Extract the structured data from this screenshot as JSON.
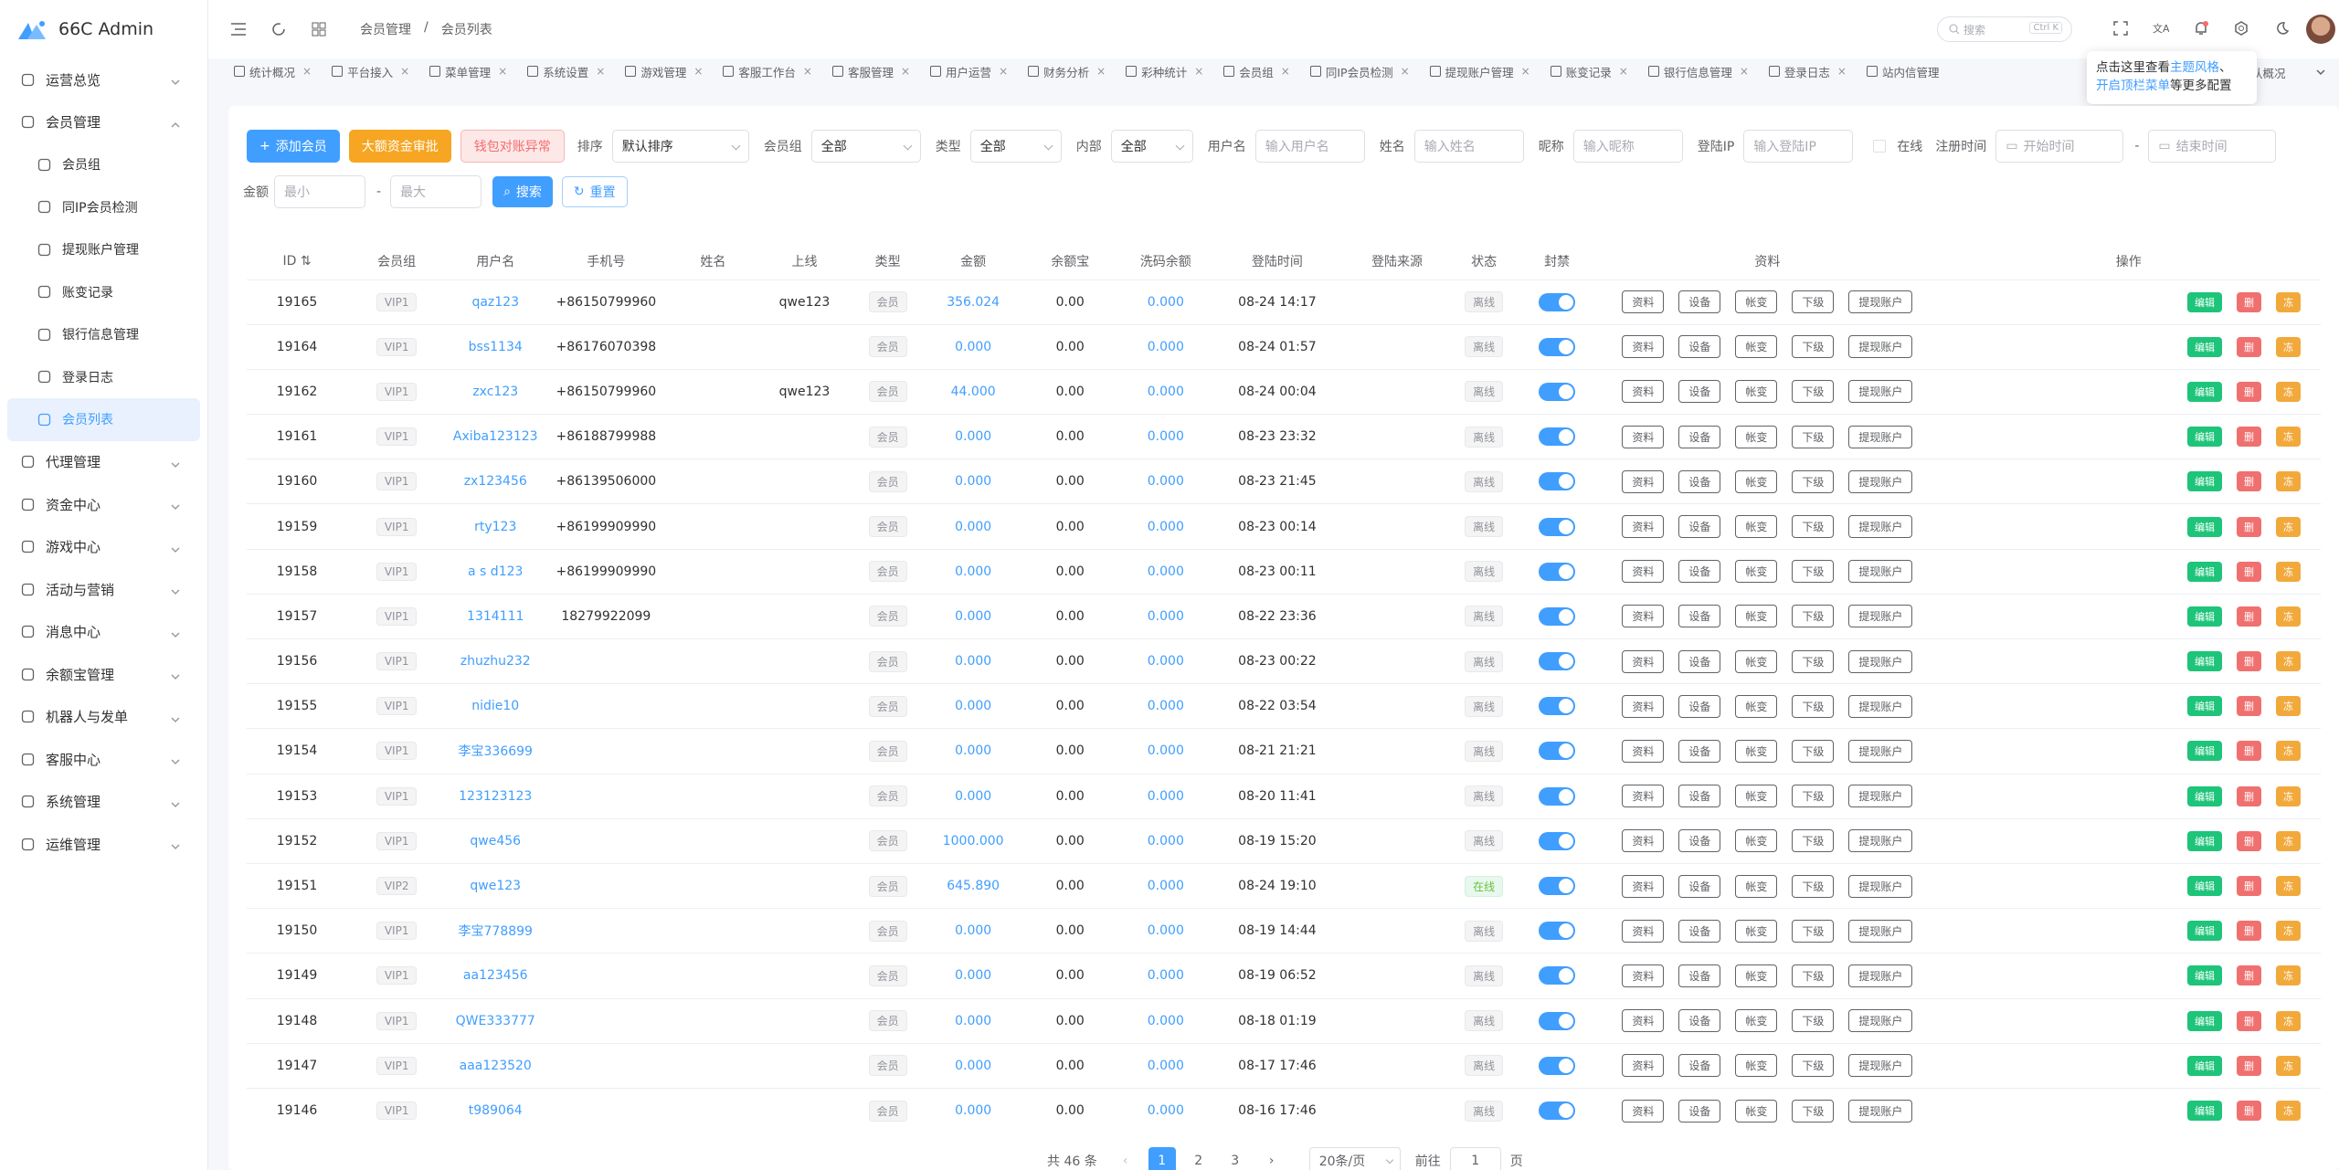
{
  "app": {
    "title": "66C Admin"
  },
  "sidebar": {
    "items": [
      {
        "label": "运营总览",
        "icon": "dashboard-icon",
        "expanded": false
      },
      {
        "label": "会员管理",
        "icon": "user-icon",
        "expanded": true
      },
      {
        "label": "会员组",
        "icon": "chat-icon",
        "sub": true
      },
      {
        "label": "同IP会员检测",
        "icon": "shield-icon",
        "sub": true
      },
      {
        "label": "提现账户管理",
        "icon": "card-icon",
        "sub": true
      },
      {
        "label": "账变记录",
        "icon": "document-icon",
        "sub": true
      },
      {
        "label": "银行信息管理",
        "icon": "bank-icon",
        "sub": true
      },
      {
        "label": "登录日志",
        "icon": "clock-icon",
        "sub": true
      },
      {
        "label": "会员列表",
        "icon": "user-icon",
        "sub": true,
        "active": true
      },
      {
        "label": "代理管理",
        "icon": "agent-icon",
        "expanded": false
      },
      {
        "label": "资金中心",
        "icon": "wallet-icon",
        "expanded": false
      },
      {
        "label": "游戏中心",
        "icon": "gamepad-icon",
        "expanded": false
      },
      {
        "label": "活动与营销",
        "icon": "gift-icon",
        "expanded": false
      },
      {
        "label": "消息中心",
        "icon": "message-icon",
        "expanded": false
      },
      {
        "label": "余额宝管理",
        "icon": "safe-icon",
        "expanded": false
      },
      {
        "label": "机器人与发单",
        "icon": "robot-icon",
        "expanded": false
      },
      {
        "label": "客服中心",
        "icon": "headset-icon",
        "expanded": false
      },
      {
        "label": "系统管理",
        "icon": "user-icon",
        "expanded": false
      },
      {
        "label": "运维管理",
        "icon": "tools-icon",
        "expanded": false
      }
    ]
  },
  "header": {
    "breadcrumb": [
      "会员管理",
      "会员列表"
    ],
    "search_placeholder": "搜索",
    "search_shortcut": "Ctrl K"
  },
  "tabs": [
    "统计概况",
    "平台接入",
    "菜单管理",
    "系统设置",
    "游戏管理",
    "客服工作台",
    "客服管理",
    "用户运营",
    "财务分析",
    "彩种统计",
    "会员组",
    "同IP会员检测",
    "提现账户管理",
    "账变记录",
    "银行信息管理",
    "登录日志",
    "站内信管理"
  ],
  "tabs_tail": "队概况",
  "tooltip": {
    "line1_prefix": "点击这里查看",
    "line1_link": "主题风格",
    "line1_suffix": "、",
    "line2_link": "开启顶栏菜单",
    "line2_suffix": "等更多配置"
  },
  "filters": {
    "add_label": "添加会员",
    "big_label": "大额资金审批",
    "wallet_label": "钱包对账异常",
    "sort_label": "排序",
    "sort_value": "默认排序",
    "group_label": "会员组",
    "group_value": "全部",
    "type_label": "类型",
    "type_value": "全部",
    "internal_label": "内部",
    "internal_value": "全部",
    "username_label": "用户名",
    "username_ph": "输入用户名",
    "name_label": "姓名",
    "name_ph": "输入姓名",
    "nick_label": "昵称",
    "nick_ph": "输入昵称",
    "ip_label": "登陆IP",
    "ip_ph": "输入登陆IP",
    "online_label": "在线",
    "regtime_label": "注册时间",
    "start_ph": "开始时间",
    "dash": "-",
    "end_ph": "结束时间",
    "amount_label": "金额",
    "min_ph": "最小",
    "max_ph": "最大",
    "search_label": "搜索",
    "reset_label": "重置"
  },
  "table": {
    "headers": [
      "ID",
      "会员组",
      "用户名",
      "手机号",
      "姓名",
      "上线",
      "类型",
      "金额",
      "余额宝",
      "洗码余额",
      "登陆时间",
      "登陆来源",
      "状态",
      "封禁",
      "资料",
      "操作"
    ],
    "row_buttons": [
      "资料",
      "设备",
      "帐变",
      "下级",
      "提现账户"
    ],
    "op_buttons": [
      "编辑",
      "删",
      "冻"
    ],
    "rows": [
      {
        "id": "19165",
        "group": "VIP1",
        "user": "qaz123",
        "phone": "+86150799960",
        "name": "",
        "up": "qwe123",
        "type": "会员",
        "amount": "356.024",
        "yeb": "0.00",
        "wash": "0.000",
        "time": "08-24 14:17",
        "status": "离线"
      },
      {
        "id": "19164",
        "group": "VIP1",
        "user": "bss1134",
        "phone": "+86176070398",
        "name": "",
        "up": "",
        "type": "会员",
        "amount": "0.000",
        "yeb": "0.00",
        "wash": "0.000",
        "time": "08-24 01:57",
        "status": "离线"
      },
      {
        "id": "19162",
        "group": "VIP1",
        "user": "zxc123",
        "phone": "+86150799960",
        "name": "",
        "up": "qwe123",
        "type": "会员",
        "amount": "44.000",
        "yeb": "0.00",
        "wash": "0.000",
        "time": "08-24 00:04",
        "status": "离线"
      },
      {
        "id": "19161",
        "group": "VIP1",
        "user": "Axiba123123",
        "phone": "+86188799988",
        "name": "",
        "up": "",
        "type": "会员",
        "amount": "0.000",
        "yeb": "0.00",
        "wash": "0.000",
        "time": "08-23 23:32",
        "status": "离线"
      },
      {
        "id": "19160",
        "group": "VIP1",
        "user": "zx123456",
        "phone": "+86139506000",
        "name": "",
        "up": "",
        "type": "会员",
        "amount": "0.000",
        "yeb": "0.00",
        "wash": "0.000",
        "time": "08-23 21:45",
        "status": "离线"
      },
      {
        "id": "19159",
        "group": "VIP1",
        "user": "rty123",
        "phone": "+86199909990",
        "name": "",
        "up": "",
        "type": "会员",
        "amount": "0.000",
        "yeb": "0.00",
        "wash": "0.000",
        "time": "08-23 00:14",
        "status": "离线"
      },
      {
        "id": "19158",
        "group": "VIP1",
        "user": "a s d123",
        "phone": "+86199909990",
        "name": "",
        "up": "",
        "type": "会员",
        "amount": "0.000",
        "yeb": "0.00",
        "wash": "0.000",
        "time": "08-23 00:11",
        "status": "离线"
      },
      {
        "id": "19157",
        "group": "VIP1",
        "user": "1314111",
        "phone": "18279922099",
        "name": "",
        "up": "",
        "type": "会员",
        "amount": "0.000",
        "yeb": "0.00",
        "wash": "0.000",
        "time": "08-22 23:36",
        "status": "离线"
      },
      {
        "id": "19156",
        "group": "VIP1",
        "user": "zhuzhu232",
        "phone": "",
        "name": "",
        "up": "",
        "type": "会员",
        "amount": "0.000",
        "yeb": "0.00",
        "wash": "0.000",
        "time": "08-23 00:22",
        "status": "离线"
      },
      {
        "id": "19155",
        "group": "VIP1",
        "user": "nidie10",
        "phone": "",
        "name": "",
        "up": "",
        "type": "会员",
        "amount": "0.000",
        "yeb": "0.00",
        "wash": "0.000",
        "time": "08-22 03:54",
        "status": "离线"
      },
      {
        "id": "19154",
        "group": "VIP1",
        "user": "李宝336699",
        "phone": "",
        "name": "",
        "up": "",
        "type": "会员",
        "amount": "0.000",
        "yeb": "0.00",
        "wash": "0.000",
        "time": "08-21 21:21",
        "status": "离线"
      },
      {
        "id": "19153",
        "group": "VIP1",
        "user": "123123123",
        "phone": "",
        "name": "",
        "up": "",
        "type": "会员",
        "amount": "0.000",
        "yeb": "0.00",
        "wash": "0.000",
        "time": "08-20 11:41",
        "status": "离线"
      },
      {
        "id": "19152",
        "group": "VIP1",
        "user": "qwe456",
        "phone": "",
        "name": "",
        "up": "",
        "type": "会员",
        "amount": "1000.000",
        "yeb": "0.00",
        "wash": "0.000",
        "time": "08-19 15:20",
        "status": "离线"
      },
      {
        "id": "19151",
        "group": "VIP2",
        "user": "qwe123",
        "phone": "",
        "name": "",
        "up": "",
        "type": "会员",
        "amount": "645.890",
        "yeb": "0.00",
        "wash": "0.000",
        "time": "08-24 19:10",
        "status": "在线"
      },
      {
        "id": "19150",
        "group": "VIP1",
        "user": "李宝778899",
        "phone": "",
        "name": "",
        "up": "",
        "type": "会员",
        "amount": "0.000",
        "yeb": "0.00",
        "wash": "0.000",
        "time": "08-19 14:44",
        "status": "离线"
      },
      {
        "id": "19149",
        "group": "VIP1",
        "user": "aa123456",
        "phone": "",
        "name": "",
        "up": "",
        "type": "会员",
        "amount": "0.000",
        "yeb": "0.00",
        "wash": "0.000",
        "time": "08-19 06:52",
        "status": "离线"
      },
      {
        "id": "19148",
        "group": "VIP1",
        "user": "QWE333777",
        "phone": "",
        "name": "",
        "up": "",
        "type": "会员",
        "amount": "0.000",
        "yeb": "0.00",
        "wash": "0.000",
        "time": "08-18 01:19",
        "status": "离线"
      },
      {
        "id": "19147",
        "group": "VIP1",
        "user": "aaa123520",
        "phone": "",
        "name": "",
        "up": "",
        "type": "会员",
        "amount": "0.000",
        "yeb": "0.00",
        "wash": "0.000",
        "time": "08-17 17:46",
        "status": "离线"
      },
      {
        "id": "19146",
        "group": "VIP1",
        "user": "t989064",
        "phone": "",
        "name": "",
        "up": "",
        "type": "会员",
        "amount": "0.000",
        "yeb": "0.00",
        "wash": "0.000",
        "time": "08-16 17:46",
        "status": "离线"
      }
    ]
  },
  "pagination": {
    "total": "共 46 条",
    "pages": [
      "1",
      "2",
      "3"
    ],
    "current": "1",
    "size": "20条/页",
    "goto": "前往",
    "goto_value": "1",
    "page_unit": "页"
  },
  "colors": {
    "primary": "#409eff",
    "warning": "#f6a623",
    "success": "#1ec479",
    "danger": "#f07070"
  }
}
